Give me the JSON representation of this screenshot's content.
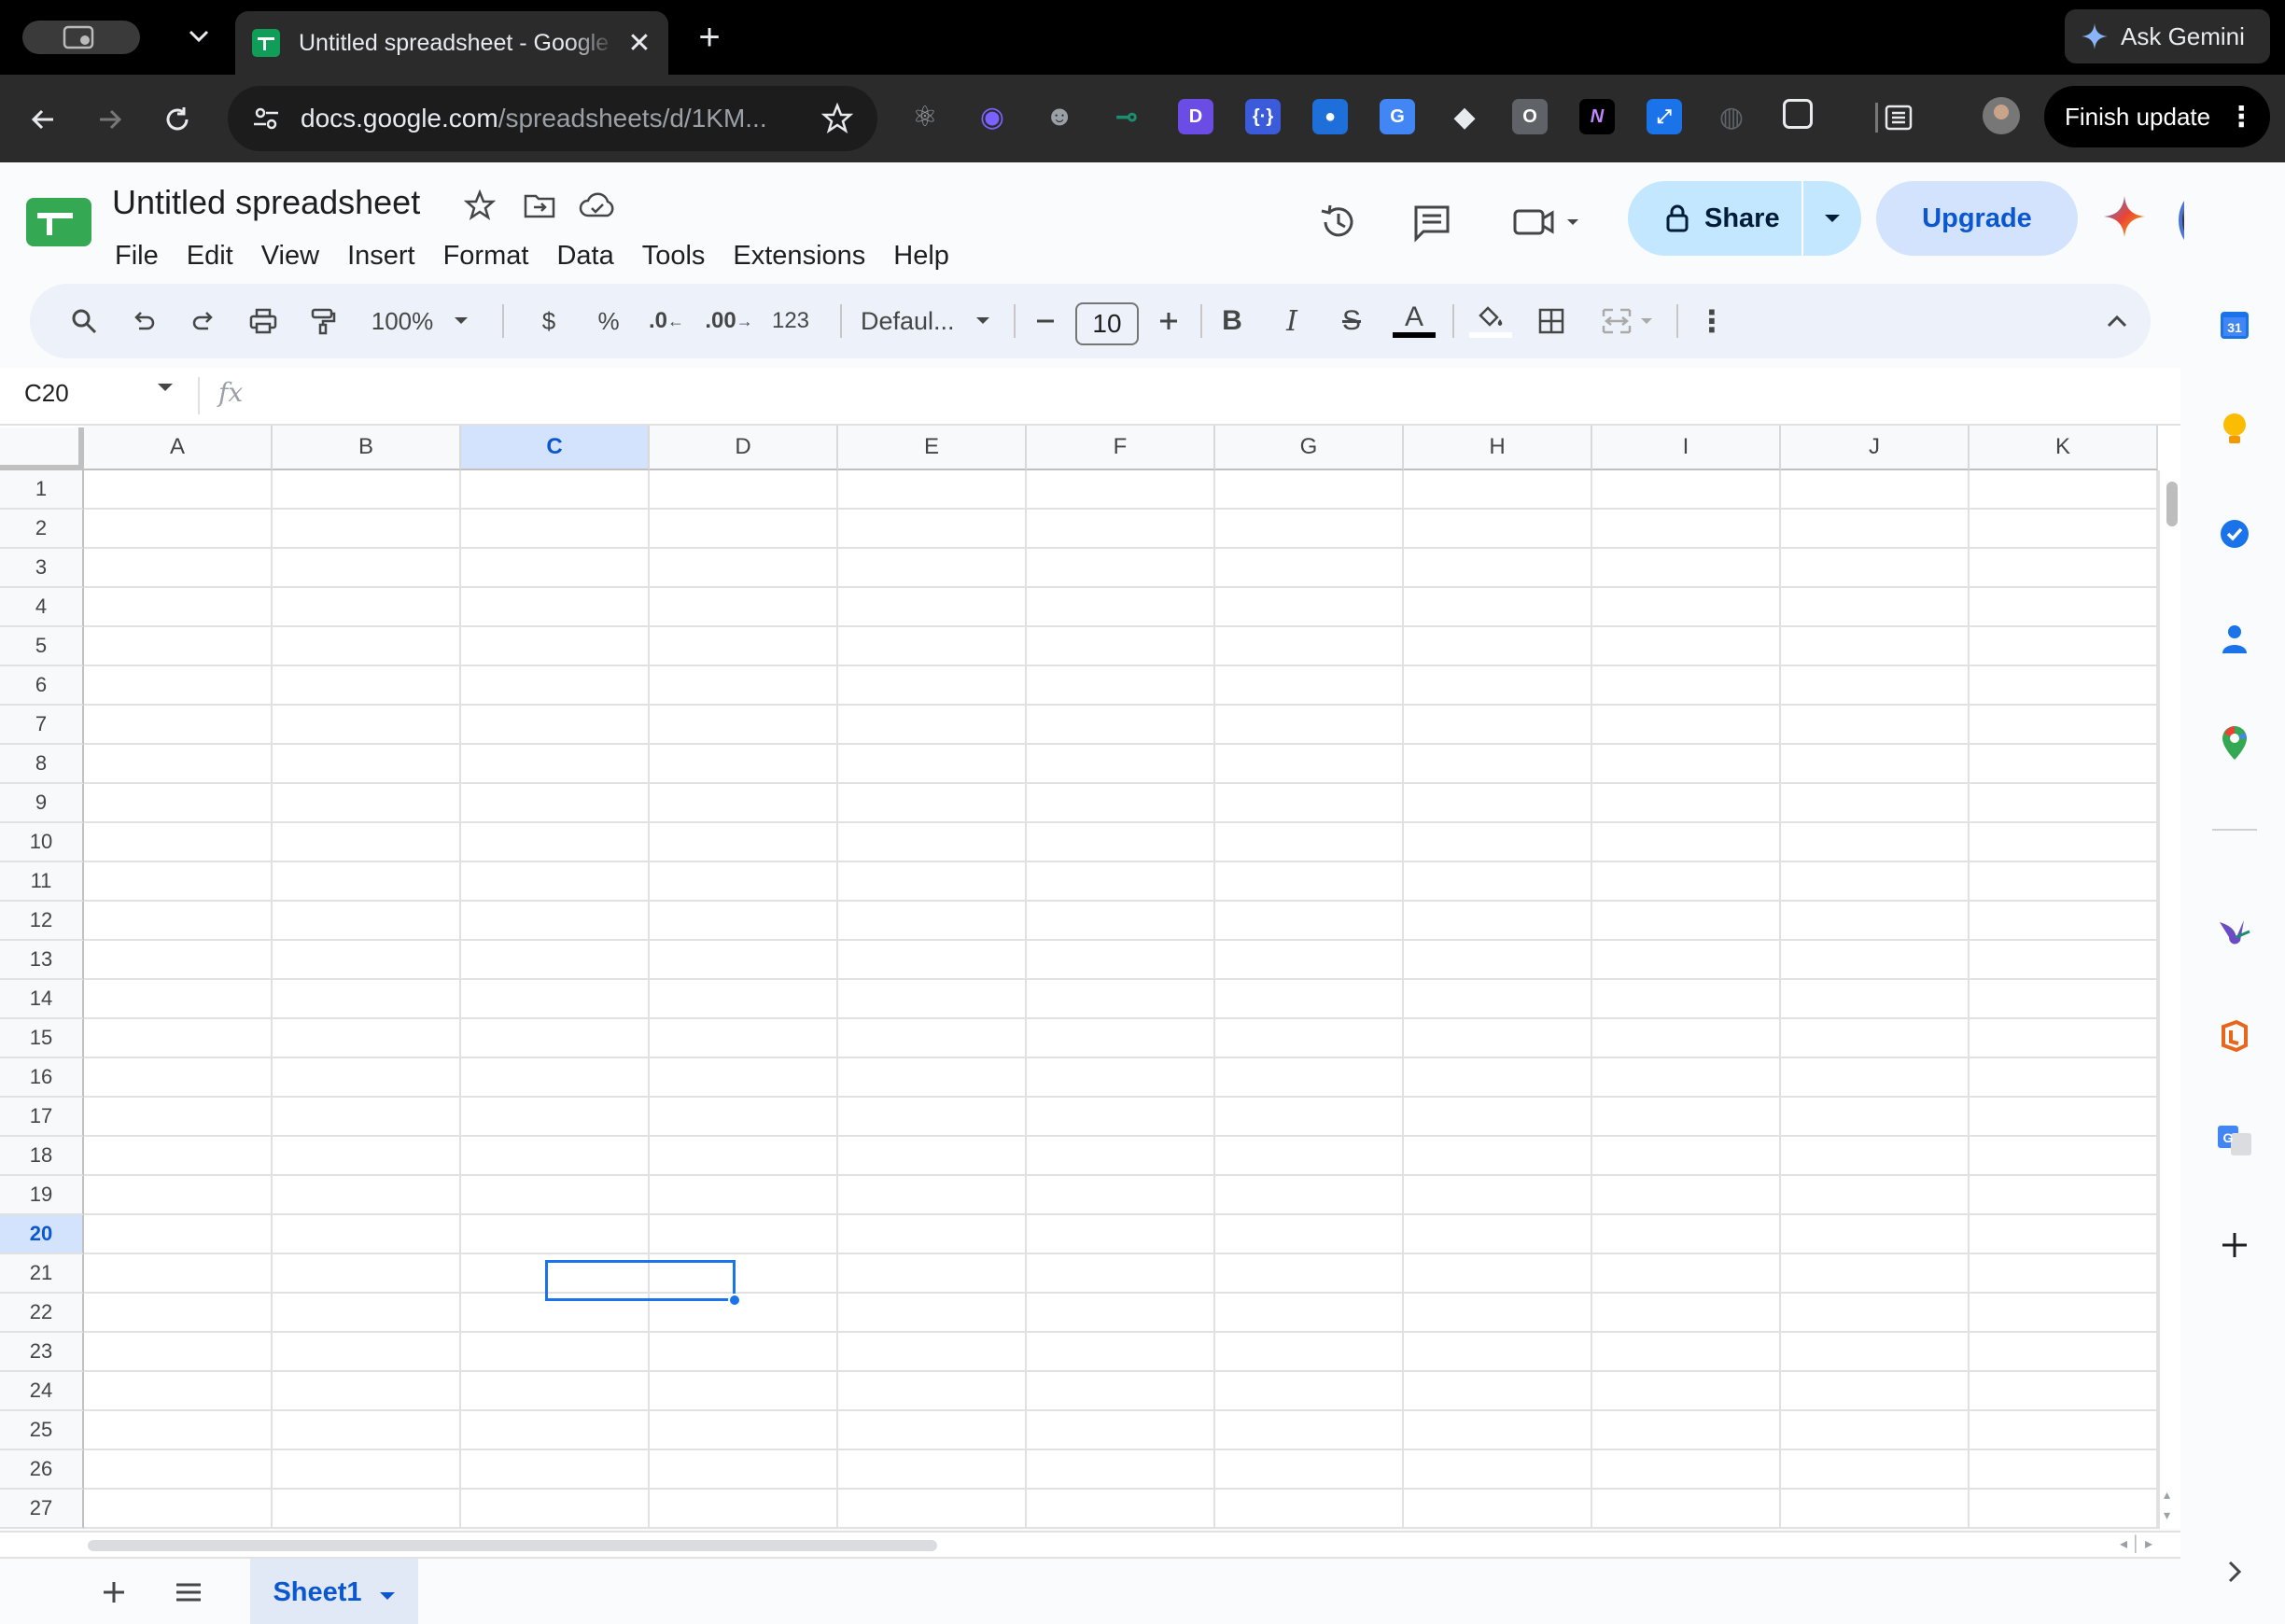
{
  "browser": {
    "tab_title": "Untitled spreadsheet - Google Sheets",
    "ask_gemini": "Ask Gemini",
    "url_host": "docs.google.com",
    "url_path": "/spreadsheets/d/1KM...",
    "finish_update": "Finish update",
    "extensions": [
      {
        "name": "react-devtools-icon",
        "color": "#9aa0a6",
        "glyph": "⚛"
      },
      {
        "name": "podcast-ext-icon",
        "color": "#7b61ff",
        "glyph": "◉"
      },
      {
        "name": "reddit-ext-icon",
        "color": "#9aa0a6",
        "glyph": "☻"
      },
      {
        "name": "git-ext-icon",
        "color": "#1a8f6f",
        "glyph": "⊸"
      },
      {
        "name": "d-ext-icon",
        "color": "#6b4de6",
        "glyph": "D"
      },
      {
        "name": "regex-ext-icon",
        "color": "#3b5bdb",
        "glyph": "{·}"
      },
      {
        "name": "gpt-ext-icon",
        "color": "#1e6fd9",
        "glyph": "●"
      },
      {
        "name": "translate-ext-icon",
        "color": "#4285f4",
        "glyph": "G"
      },
      {
        "name": "eraser-ext-icon",
        "color": "#e8eaed",
        "glyph": "◆"
      },
      {
        "name": "o-ext-icon",
        "color": "#5f6368",
        "glyph": "O"
      },
      {
        "name": "n-ext-icon",
        "color": "#000000",
        "glyph": "N"
      },
      {
        "name": "x-ext-icon",
        "color": "#1a73e8",
        "glyph": "⤢"
      },
      {
        "name": "rec-ext-icon",
        "color": "#5f6368",
        "glyph": "◍"
      },
      {
        "name": "puzzle-icon",
        "color": "#2b2b2b",
        "glyph": "⬚"
      }
    ]
  },
  "doc": {
    "title": "Untitled spreadsheet",
    "menu": [
      "File",
      "Edit",
      "View",
      "Insert",
      "Format",
      "Data",
      "Tools",
      "Extensions",
      "Help"
    ],
    "share_label": "Share",
    "upgrade_label": "Upgrade"
  },
  "toolbar": {
    "zoom": "100%",
    "currency": "$",
    "percent": "%",
    "dec_decrease": ".0",
    "dec_increase": ".00",
    "number_format": "123",
    "font": "Defaul...",
    "font_size": "10",
    "bold": "B",
    "italic": "I",
    "strike": "S",
    "text_color": "A"
  },
  "formula_bar": {
    "cell_ref": "C20",
    "fx": "fx",
    "value": ""
  },
  "grid": {
    "columns": [
      "A",
      "B",
      "C",
      "D",
      "E",
      "F",
      "G",
      "H",
      "I",
      "J",
      "K"
    ],
    "rows": [
      "1",
      "2",
      "3",
      "4",
      "5",
      "6",
      "7",
      "8",
      "9",
      "10",
      "11",
      "12",
      "13",
      "14",
      "15",
      "16",
      "17",
      "18",
      "19",
      "20",
      "21",
      "22",
      "23",
      "24",
      "25",
      "26",
      "27"
    ],
    "selected_column": "C",
    "selected_row": "20"
  },
  "sheets": {
    "tabs": [
      "Sheet1"
    ]
  },
  "colors": {
    "accent": "#1a73e8",
    "selection_header": "#d3e3fd",
    "share_bg": "#c2e7ff"
  }
}
